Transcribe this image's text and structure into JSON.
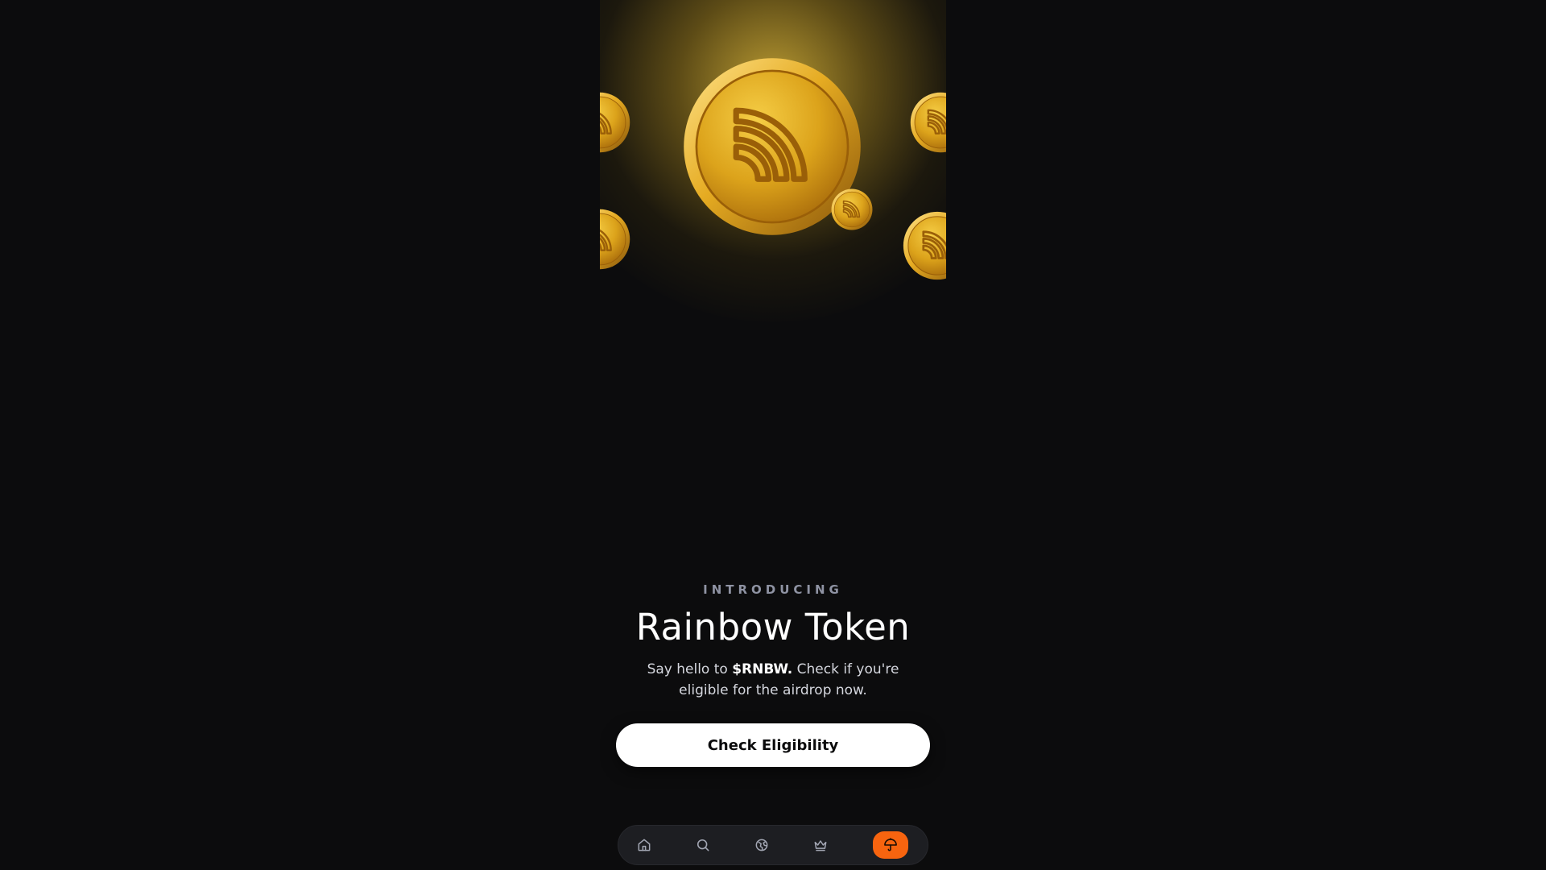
{
  "hero": {
    "eyebrow": "INTRODUCING",
    "title": "Rainbow Token",
    "subtitle_prefix": "Say hello to ",
    "subtitle_ticker": "$RNBW.",
    "subtitle_suffix": " Check if you're eligible for the airdrop now.",
    "coin_icon": "rainbow-token-coin-icon"
  },
  "cta": {
    "label": "Check Eligibility"
  },
  "nav": {
    "items": [
      {
        "name": "home",
        "icon": "home-icon",
        "active": false
      },
      {
        "name": "search",
        "icon": "search-icon",
        "active": false
      },
      {
        "name": "discover",
        "icon": "globe-icon",
        "active": false
      },
      {
        "name": "leaderboard",
        "icon": "crown-icon",
        "active": false
      },
      {
        "name": "airdrop",
        "icon": "umbrella-icon",
        "active": true
      }
    ],
    "active_color": "#f7640f"
  },
  "colors": {
    "background": "#0c0c0d",
    "coin_gold": "#e3a818",
    "eyebrow": "#8f93a3",
    "button_bg": "#ffffff"
  }
}
